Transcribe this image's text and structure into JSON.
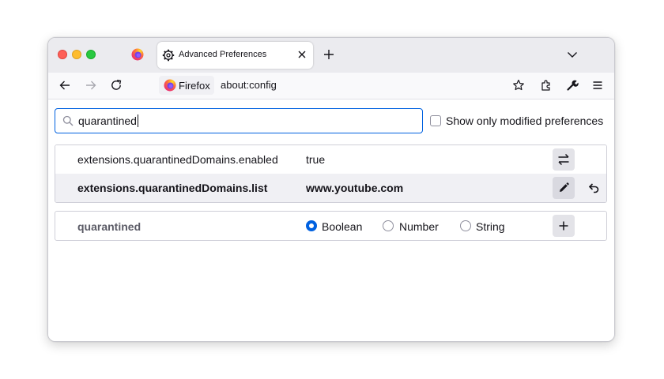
{
  "tabs": [
    {
      "title": "Advanced Preferences",
      "icon": "gear-icon",
      "active": true
    }
  ],
  "navbar": {
    "identity_label": "Firefox",
    "url": "about:config"
  },
  "search": {
    "value": "quarantined",
    "show_modified_label": "Show only modified preferences",
    "show_modified_checked": false
  },
  "prefs": [
    {
      "name": "extensions.quarantinedDomains.enabled",
      "value": "true",
      "modified": false,
      "action": "toggle-icon"
    },
    {
      "name": "extensions.quarantinedDomains.list",
      "value": "www.youtube.com",
      "modified": true,
      "action": "edit-icon"
    }
  ],
  "new_pref": {
    "name": "quarantined",
    "types": [
      "Boolean",
      "Number",
      "String"
    ],
    "selected_type": "Boolean"
  },
  "colors": {
    "accent": "#0061e0",
    "close": "#fe5f57",
    "minimize": "#febc2e",
    "maximize": "#28c840"
  }
}
